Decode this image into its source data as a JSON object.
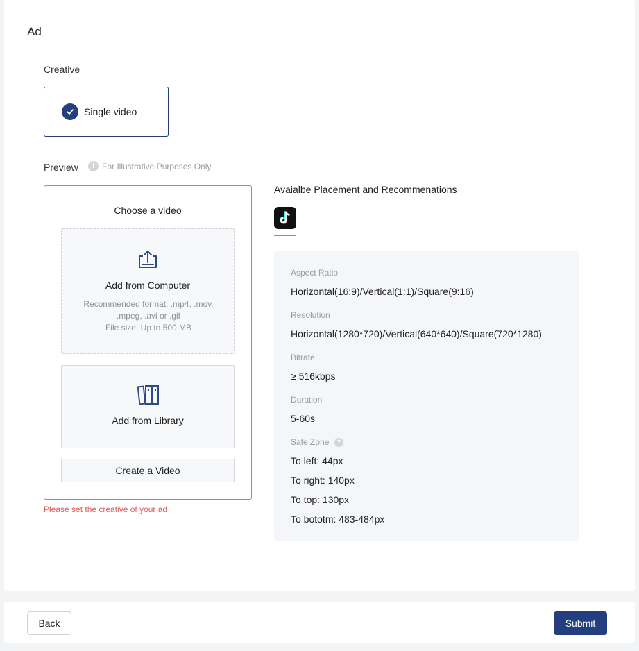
{
  "page": {
    "title": "Ad"
  },
  "creative": {
    "label": "Creative",
    "option": {
      "label": "Single video",
      "selected": true,
      "icon": "check-circle-icon"
    }
  },
  "preview": {
    "label": "Preview",
    "info_icon": "info-icon",
    "note": "For Illustrative Purposes Only"
  },
  "chooser": {
    "title": "Choose a video",
    "computer": {
      "icon": "upload-icon",
      "label": "Add from Computer",
      "hint_line1": "Recommended format: .mp4, .mov,",
      "hint_line2": ".mpeg, .avi or .gif",
      "hint_line3": "File size: Up to 500 MB"
    },
    "library": {
      "icon": "library-icon",
      "label": "Add from Library"
    },
    "create_label": "Create a Video",
    "error": "Please set the creative of your ad"
  },
  "placement": {
    "title": "Avaialbe Placement and Recommenations",
    "tabs": [
      {
        "icon": "tiktok-icon",
        "active": true
      }
    ],
    "accent": "#26b8d9",
    "specs": {
      "aspect_ratio_label": "Aspect Ratio",
      "aspect_ratio_value": "Horizontal(16:9)/Vertical(1:1)/Square(9:16)",
      "resolution_label": "Resolution",
      "resolution_value": "Horizontal(1280*720)/Vertical(640*640)/Square(720*1280)",
      "bitrate_label": "Bitrate",
      "bitrate_value": "≥ 516kbps",
      "duration_label": "Duration",
      "duration_value": "5-60s",
      "safe_zone_label": "Safe Zone",
      "safe_zone_help_icon": "help-icon",
      "safe_zone_left": "To left: 44px",
      "safe_zone_right": "To right: 140px",
      "safe_zone_top": "To top: 130px",
      "safe_zone_bottom": "To bototm: 483-484px"
    }
  },
  "footer": {
    "back_label": "Back",
    "submit_label": "Submit"
  },
  "colors": {
    "primary": "#233f7f",
    "error": "#e25b5b",
    "error_border": "#ea6b6b"
  }
}
